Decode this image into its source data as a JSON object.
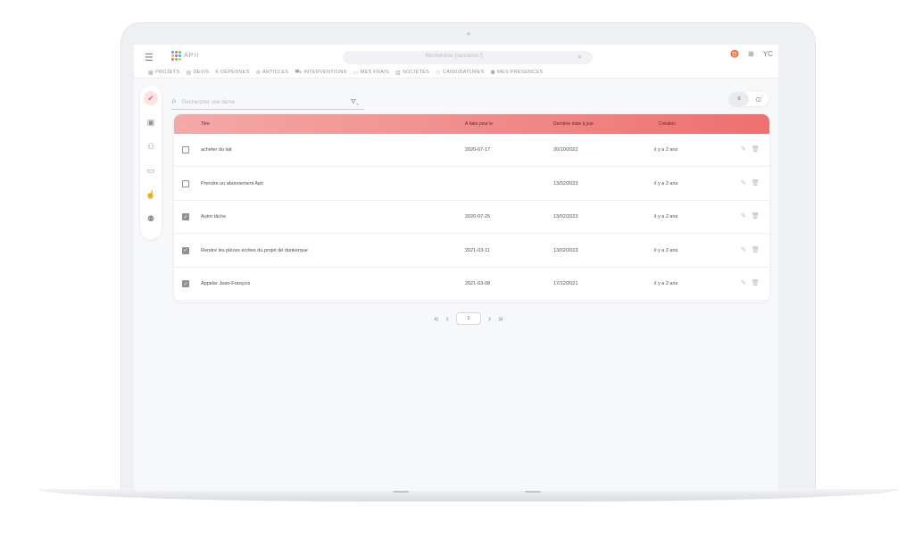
{
  "topbar": {
    "logo_text": "APII",
    "logo_colors": [
      "#2fb5e8",
      "#f26a6a",
      "#6cc36c",
      "#f5b43a",
      "#9b6fd1",
      "#2fb5e8",
      "#f26a6a",
      "#6cc36c",
      "#f5b43a"
    ],
    "search_placeholder": "Rechercher (raccourci /)",
    "user_initials": "YC"
  },
  "nav": [
    {
      "label": "PROJETS",
      "icon": "projects-icon"
    },
    {
      "label": "DEVIS",
      "icon": "quote-icon"
    },
    {
      "label": "DÉPENSES",
      "icon": "euro-icon"
    },
    {
      "label": "ARTICLES",
      "icon": "articles-icon"
    },
    {
      "label": "INTERVENTIONS",
      "icon": "interventions-icon"
    },
    {
      "label": "MES FRAIS",
      "icon": "expenses-icon"
    },
    {
      "label": "SOCIÉTÉS",
      "icon": "company-icon"
    },
    {
      "label": "CANDIDATURES",
      "icon": "applications-icon"
    },
    {
      "label": "MES PRÉSENCES",
      "icon": "attendance-icon"
    }
  ],
  "rail": [
    "tasks-icon",
    "calendar-icon",
    "contacts-icon",
    "wallet-icon",
    "thumbs-up-icon",
    "team-icon"
  ],
  "tasks": {
    "search_placeholder": "Rechercher une tâche",
    "columns": {
      "title": "Titre",
      "due": "À faire pour le",
      "updated": "Dernière mise à jour",
      "created": "Création"
    },
    "rows": [
      {
        "title": "acheter du lait",
        "due": "2020-07-17",
        "updated": "20/10/2022",
        "created": "il y a 2 ans",
        "done": false
      },
      {
        "title": "Prendre un abonnement Apii",
        "due": "",
        "updated": "13/02/2023",
        "created": "il y a 2 ans",
        "done": false
      },
      {
        "title": "Autre tâche",
        "due": "2020-07-25",
        "updated": "13/02/2023",
        "created": "il y a 2 ans",
        "done": true
      },
      {
        "title": "Rendre les pièces écrites du projet de dunkerque",
        "due": "2021-03-11",
        "updated": "13/02/2023",
        "created": "il y a 2 ans",
        "done": true
      },
      {
        "title": "Appeler Jean-François",
        "due": "2021-03-08",
        "updated": "17/12/2021",
        "created": "il y a 2 ans",
        "done": true
      }
    ]
  },
  "pagination": {
    "current_page": "1"
  },
  "colors": {
    "accent": "#ee7070",
    "accent_light": "#f4a9a9"
  }
}
